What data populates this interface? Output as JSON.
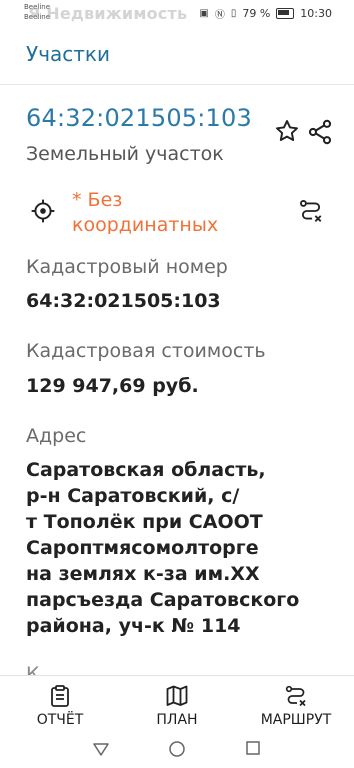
{
  "status_bar": {
    "carrier_1": "Beeline",
    "carrier_2": "Beeline",
    "watermark": "Я  Недвижимость",
    "battery": "79 %",
    "time": "10:30"
  },
  "header": {
    "title": "Участки"
  },
  "parcel": {
    "number": "64:32:021505:103",
    "type": "Земельный участок",
    "no_coordinates": "* Без координатных"
  },
  "details": {
    "cadastral_number_label": "Кадастровый номер",
    "cadastral_number_value": "64:32:021505:103",
    "cadastral_cost_label": "Кадастровая стоимость",
    "cadastral_cost_value": "129 947,69 руб.",
    "address_label": "Адрес",
    "address_lines": [
      "Саратовская область,",
      "р-н Саратовский, с/",
      "т Тополёк при САООТ",
      "Сароптмясомолторге",
      "на землях к-за им.XX",
      "парсъезда Саратовского",
      "района, уч-к № 114"
    ],
    "next_label_partial": "К"
  },
  "bottom_bar": {
    "report_label": "ОТЧЁТ",
    "plan_label": "ПЛАН",
    "route_label": "МАРШРУТ"
  },
  "colors": {
    "accent_blue": "#2b7aa8",
    "orange_warning": "#f07238"
  },
  "icons": [
    "star-icon",
    "share-icon",
    "locate-icon",
    "route-icon",
    "report-icon",
    "map-icon",
    "back-icon",
    "home-icon",
    "recent-apps-icon"
  ]
}
